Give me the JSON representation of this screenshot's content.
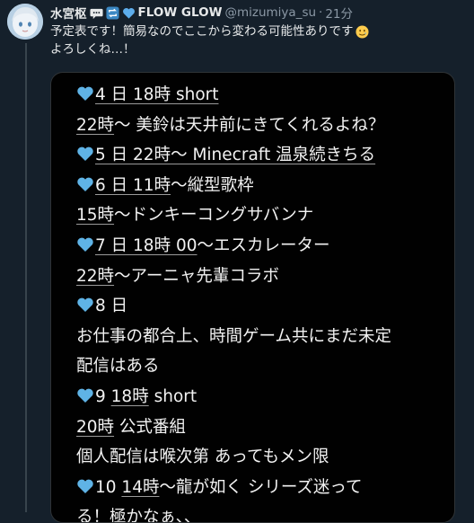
{
  "tweet": {
    "author_name": "水宮枢",
    "badge_text": "FLOW GLOW",
    "handle": "@mizumiya_su",
    "separator": "·",
    "time": "21分",
    "text_line1": "予定表です！簡易なのでここから変わる可能性ありです",
    "text_line2": "よろしくね…！"
  },
  "schedule": {
    "l1": "4 日 18時 short",
    "l2a": "22時",
    "l2b": "〜 美鈴は天井前にきてくれるよね？",
    "l3": "5 日 22時〜 Minecraft 温泉続きちる",
    "l4a": "6 日 11時",
    "l4b": "〜縦型歌枠",
    "l5a": "15時",
    "l5b": "〜ドンキーコングサバンナ",
    "l6a": "7 日 18時 00",
    "l6b": "〜エスカレーター",
    "l7a": "22時",
    "l7b": "〜アーニャ先輩コラボ",
    "l8": "8 日",
    "l9": "お仕事の都合上、時間ゲーム共にまだ未定",
    "l10": "配信はある",
    "l11a": "9 ",
    "l11b": "18時",
    "l11c": " short",
    "l12a": "20時",
    "l12b": " 公式番組",
    "l13": "個人配信は喉次第 あってもメン限",
    "l14a": "10 ",
    "l14b": "14時",
    "l14c": "〜龍が如く シリーズ迷って",
    "l15": "る！極かなぁ、、"
  },
  "colors": {
    "heart": "#5fb3e6",
    "background": "#15202b",
    "accent": "#1d9bf0"
  },
  "icons": [
    "speech-bubble-icon",
    "retweet-icon",
    "blue-heart-icon",
    "smiling-tear-emoji-icon",
    "light-blue-heart-icon"
  ]
}
